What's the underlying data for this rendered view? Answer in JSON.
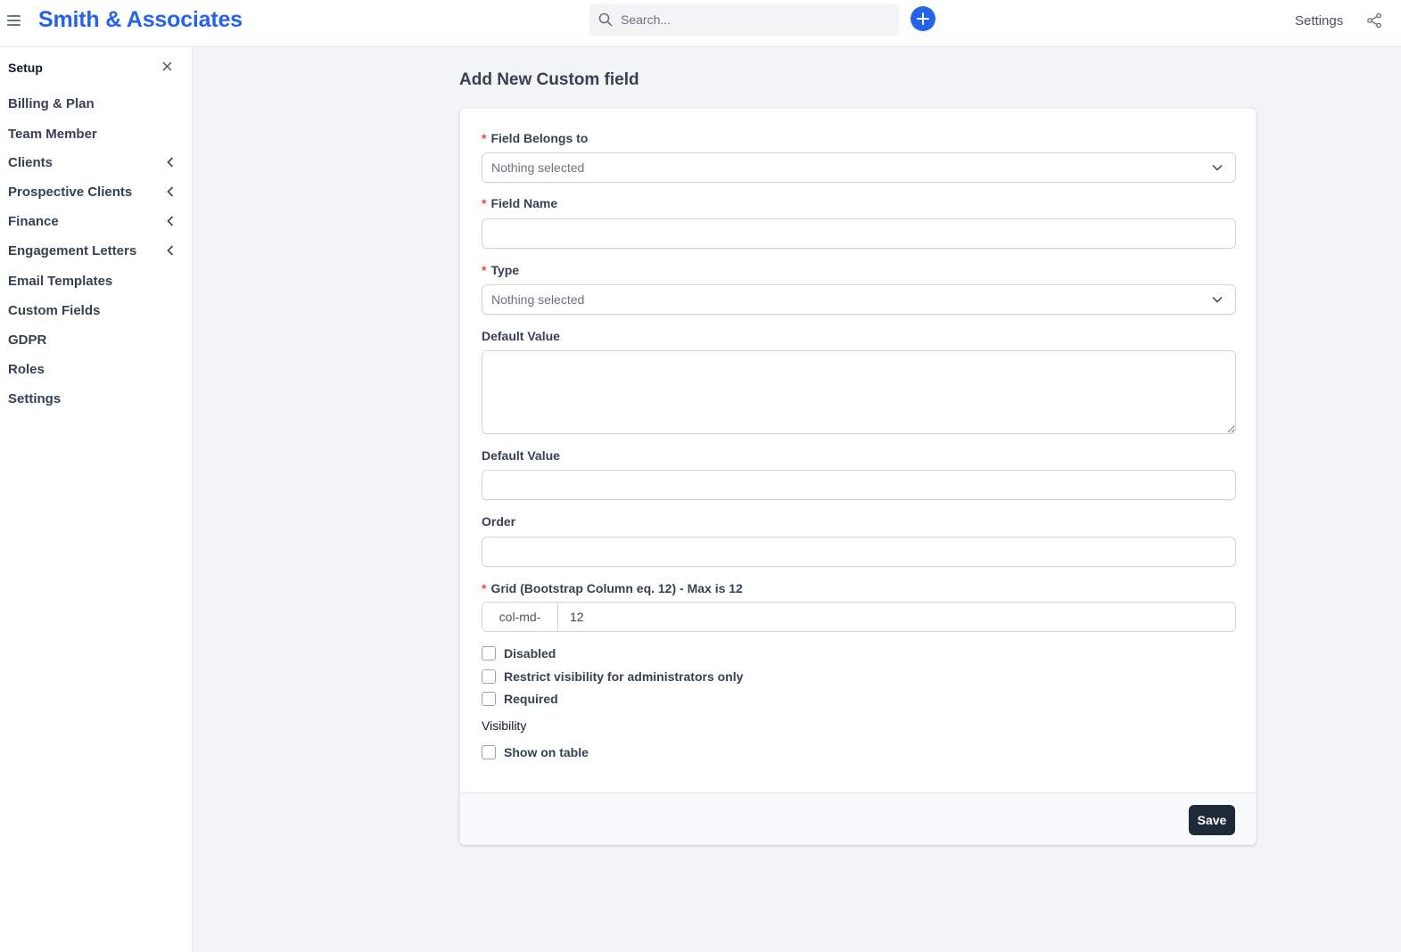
{
  "header": {
    "brand": "Smith & Associates",
    "search_placeholder": "Search...",
    "settings_label": "Settings"
  },
  "sidebar": {
    "title": "Setup",
    "items": [
      {
        "label": "Billing & Plan",
        "has_children": false
      },
      {
        "label": "Team Member",
        "has_children": false
      },
      {
        "label": "Clients",
        "has_children": true
      },
      {
        "label": "Prospective Clients",
        "has_children": true
      },
      {
        "label": "Finance",
        "has_children": true
      },
      {
        "label": "Engagement Letters",
        "has_children": true
      },
      {
        "label": "Email Templates",
        "has_children": false
      },
      {
        "label": "Custom Fields",
        "has_children": false
      },
      {
        "label": "GDPR",
        "has_children": false
      },
      {
        "label": "Roles",
        "has_children": false
      },
      {
        "label": "Settings",
        "has_children": false
      }
    ]
  },
  "form": {
    "title": "Add New Custom field",
    "field_belongs_to": {
      "label": "Field Belongs to",
      "value": "Nothing selected"
    },
    "field_name": {
      "label": "Field Name",
      "value": ""
    },
    "type": {
      "label": "Type",
      "value": "Nothing selected"
    },
    "default_value_textarea": {
      "label": "Default Value",
      "value": ""
    },
    "default_value_input": {
      "label": "Default Value",
      "value": ""
    },
    "order": {
      "label": "Order",
      "value": ""
    },
    "grid": {
      "label": "Grid (Bootstrap Column eq. 12) - Max is 12",
      "prefix": "col-md-",
      "value": "12"
    },
    "checkboxes": {
      "disabled": "Disabled",
      "admin_only": "Restrict visibility for administrators only",
      "required": "Required"
    },
    "visibility_label": "Visibility",
    "show_on_table": "Show on table",
    "save_label": "Save"
  },
  "colors": {
    "brand": "#2563eb",
    "required_marker": "#ef4444",
    "save_button": "#1f2937"
  }
}
